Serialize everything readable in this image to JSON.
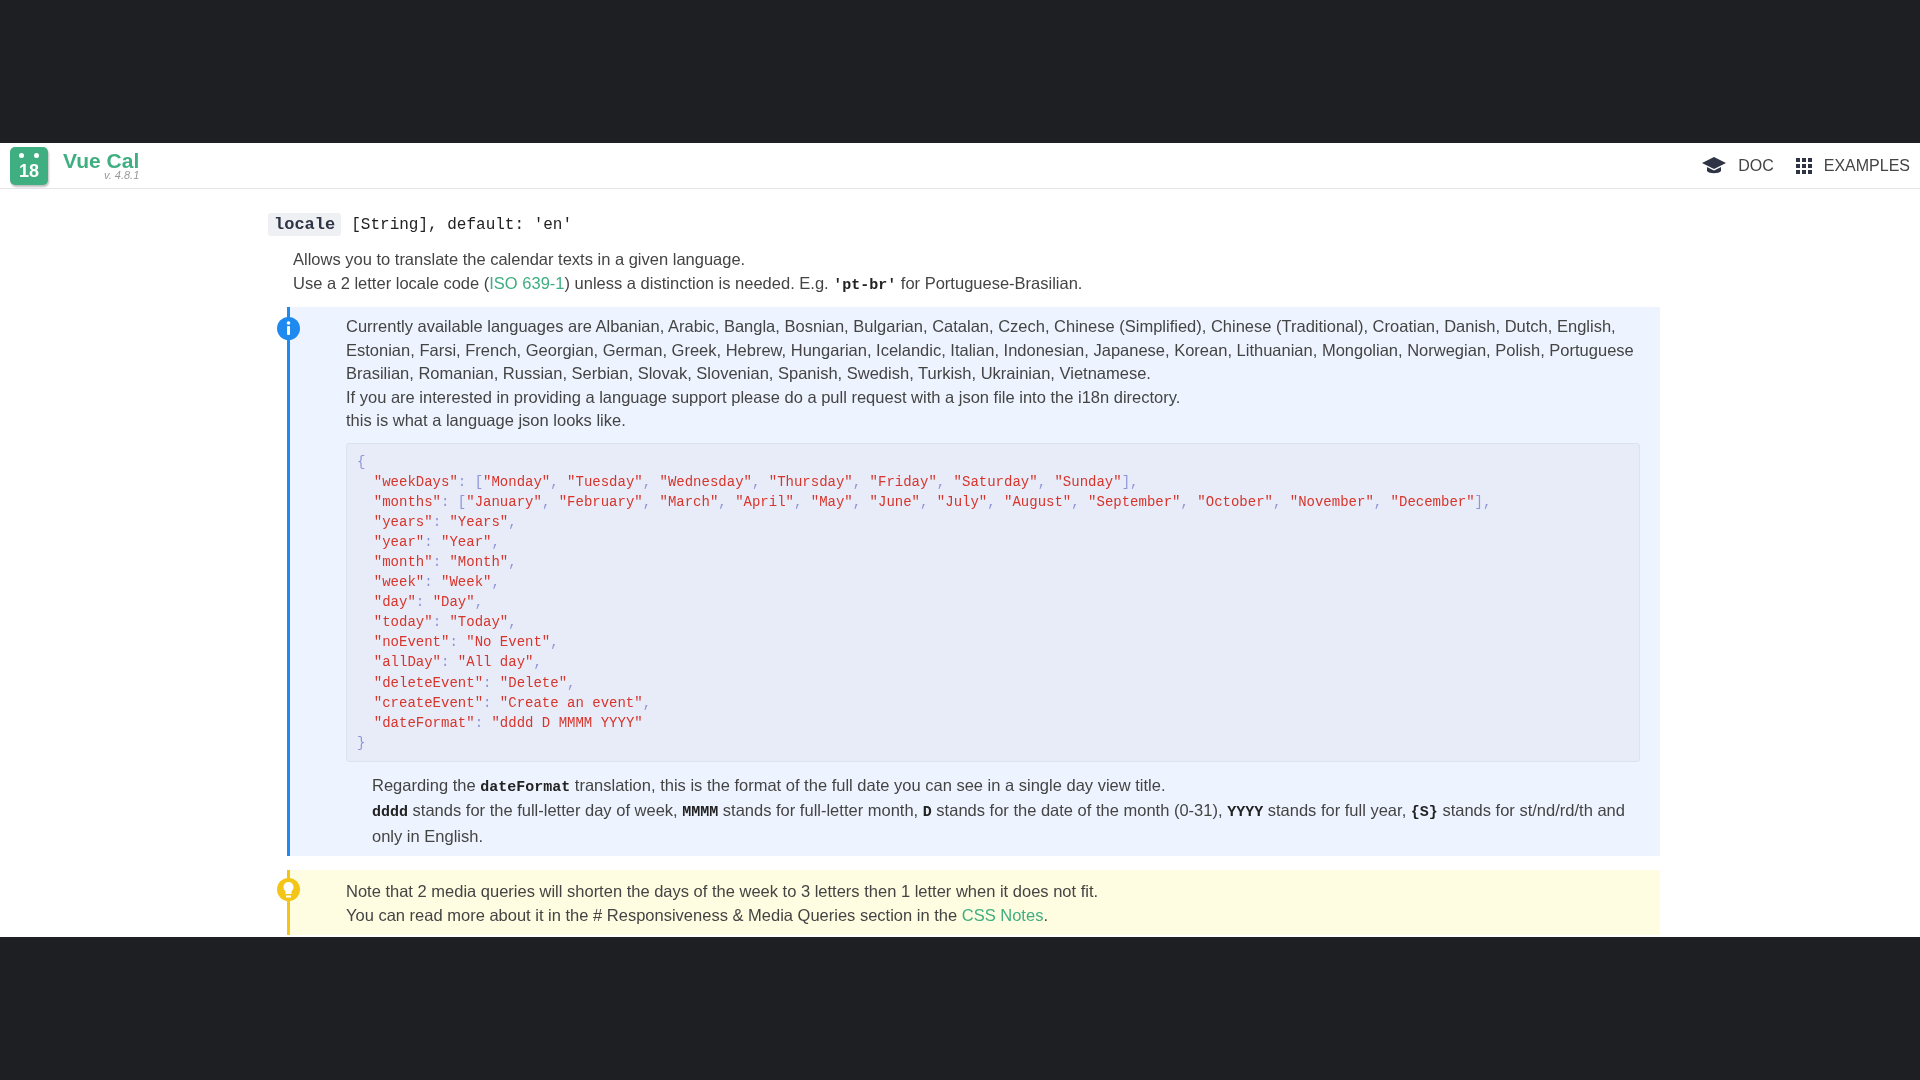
{
  "header": {
    "logo_day": "18",
    "title": "Vue Cal",
    "version": "v. 4.8.1",
    "nav": [
      {
        "kind": "doc",
        "label": "DOC"
      },
      {
        "kind": "grid",
        "label": "EXAMPLES"
      }
    ]
  },
  "option": {
    "name": "locale",
    "signature": "[String], default: 'en'"
  },
  "description": [
    [
      {
        "kind": "text",
        "text": "Allows you to translate the calendar texts in a given language."
      }
    ],
    [
      {
        "kind": "text",
        "text": "Use a 2 letter locale code ("
      },
      {
        "kind": "link",
        "text": "ISO 639-1"
      },
      {
        "kind": "text",
        "text": ") unless a distinction is needed. E.g. "
      },
      {
        "kind": "code",
        "text": "'pt-br'"
      },
      {
        "kind": "text",
        "text": " for Portuguese-Brasilian."
      }
    ]
  ],
  "info": {
    "paragraphs": [
      [
        {
          "kind": "text",
          "text": "Currently available languages are Albanian, Arabic, Bangla, Bosnian, Bulgarian, Catalan, Czech, Chinese (Simplified), Chinese (Traditional), Croatian, Danish, Dutch, English, Estonian, Farsi, French, Georgian, German, Greek, Hebrew, Hungarian, Icelandic, Italian, Indonesian, Japanese, Korean, Lithuanian, Mongolian, Norwegian, Polish, Portuguese Brasilian, Romanian, Russian, Serbian, Slovak, Slovenian, Spanish, Swedish, Turkish, Ukrainian, Vietnamese."
        }
      ],
      [
        {
          "kind": "text",
          "text": "If you are interested in providing a language support please do a pull request with a json file into the i18n directory."
        }
      ],
      [
        {
          "kind": "text",
          "text": "this is what a language json looks like."
        }
      ]
    ],
    "code_lines": [
      "{",
      "  \"weekDays\": [\"Monday\", \"Tuesday\", \"Wednesday\", \"Thursday\", \"Friday\", \"Saturday\", \"Sunday\"],",
      "  \"months\": [\"January\", \"February\", \"March\", \"April\", \"May\", \"June\", \"July\", \"August\", \"September\", \"October\", \"November\", \"December\"],",
      "  \"years\": \"Years\",",
      "  \"year\": \"Year\",",
      "  \"month\": \"Month\",",
      "  \"week\": \"Week\",",
      "  \"day\": \"Day\",",
      "  \"today\": \"Today\",",
      "  \"noEvent\": \"No Event\",",
      "  \"allDay\": \"All day\",",
      "  \"deleteEvent\": \"Delete\",",
      "  \"createEvent\": \"Create an event\",",
      "  \"dateFormat\": \"dddd D MMMM YYYY\"",
      "}"
    ],
    "notes": [
      [
        {
          "kind": "text",
          "text": "Regarding the "
        },
        {
          "kind": "code",
          "text": "dateFormat"
        },
        {
          "kind": "text",
          "text": " translation, this is the format of the full date you can see in a single day view title."
        }
      ],
      [
        {
          "kind": "code",
          "text": "dddd"
        },
        {
          "kind": "text",
          "text": " stands for the full-letter day of week, "
        },
        {
          "kind": "code",
          "text": "MMMM"
        },
        {
          "kind": "text",
          "text": " stands for full-letter month, "
        },
        {
          "kind": "code",
          "text": "D"
        },
        {
          "kind": "text",
          "text": " stands for the date of the month (0-31), "
        },
        {
          "kind": "code",
          "text": "YYYY"
        },
        {
          "kind": "text",
          "text": " stands for full year, "
        },
        {
          "kind": "code",
          "text": "{S}"
        },
        {
          "kind": "text",
          "text": " stands for st/nd/rd/th and only in English."
        }
      ]
    ]
  },
  "warning": {
    "paragraphs": [
      [
        {
          "kind": "text",
          "text": "Note that 2 media queries will shorten the days of the week to 3 letters then 1 letter when it does not fit."
        }
      ],
      [
        {
          "kind": "text",
          "text": "You can read more about it in the # Responsiveness & Media Queries section in the "
        },
        {
          "kind": "link",
          "text": "CSS Notes"
        },
        {
          "kind": "text",
          "text": "."
        }
      ]
    ]
  }
}
